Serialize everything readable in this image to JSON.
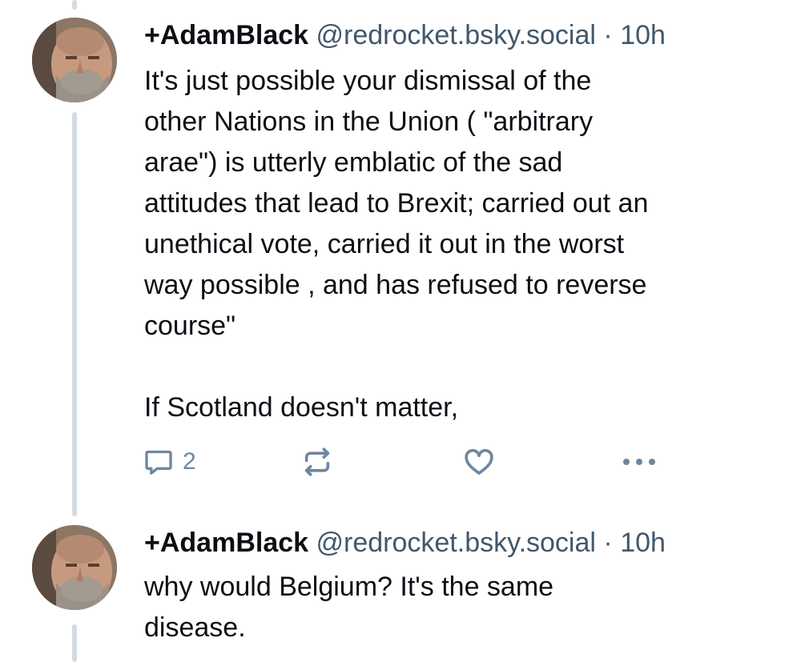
{
  "posts": [
    {
      "author_name": "+AdamBlack",
      "handle": "@redrocket.bsky.social",
      "separator": "·",
      "time": "10h",
      "text": "It's just possible your dismissal of the\nother Nations in the Union ( \"arbitrary\narae\") is utterly emblatic of the sad\nattitudes that lead to Brexit; carried out an\nunethical vote, carried it out in the worst\nway possible , and has refused to reverse\ncourse\"\n\nIf Scotland doesn't matter,",
      "reply_count": "2",
      "icons": {
        "reply": "reply-icon",
        "repost": "repost-icon",
        "like": "heart-icon",
        "more": "more-options-icon"
      }
    },
    {
      "author_name": "+AdamBlack",
      "handle": "@redrocket.bsky.social",
      "separator": "·",
      "time": "10h",
      "text": "why would Belgium? It's the same\ndisease."
    }
  ],
  "colors": {
    "text": "#0b0f14",
    "muted": "#42576c",
    "icon": "#6f869f",
    "thread_line": "#d4dbe2"
  }
}
